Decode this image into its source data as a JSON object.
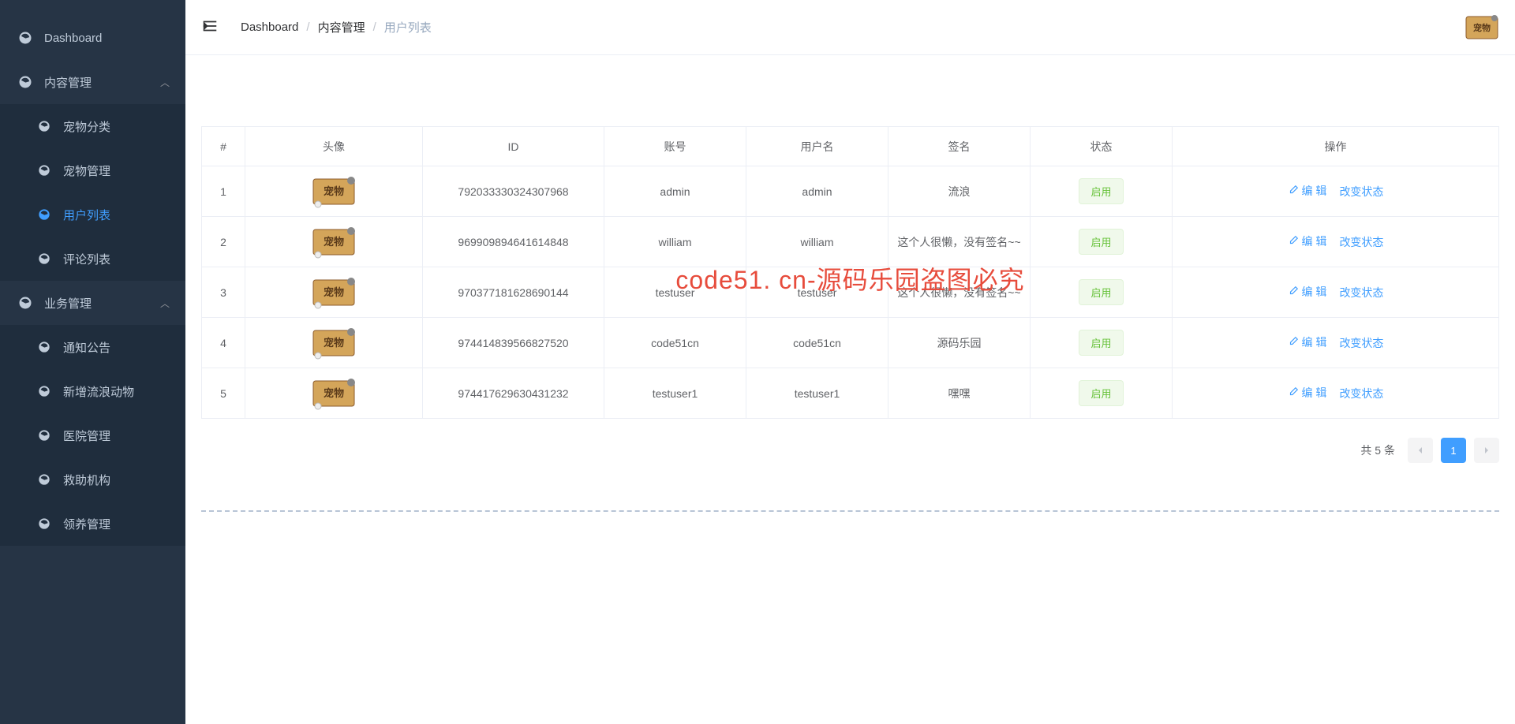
{
  "sidebar": {
    "dashboard": "Dashboard",
    "content_mgmt": "内容管理",
    "content_sub": [
      "宠物分类",
      "宠物管理",
      "用户列表",
      "评论列表"
    ],
    "business_mgmt": "业务管理",
    "business_sub": [
      "通知公告",
      "新增流浪动物",
      "医院管理",
      "救助机构",
      "领养管理"
    ]
  },
  "breadcrumb": {
    "dashboard": "Dashboard",
    "content": "内容管理",
    "current": "用户列表"
  },
  "watermark": "code51. cn-源码乐园盗图必究",
  "table": {
    "headers": {
      "idx": "#",
      "avatar": "头像",
      "id": "ID",
      "account": "账号",
      "username": "用户名",
      "sign": "签名",
      "status": "状态",
      "op": "操作"
    },
    "status_label": "启用",
    "edit_label": "编 辑",
    "change_label": "改变状态",
    "rows": [
      {
        "idx": "1",
        "id": "792033330324307968",
        "account": "admin",
        "username": "admin",
        "sign": "流浪"
      },
      {
        "idx": "2",
        "id": "969909894641614848",
        "account": "william",
        "username": "william",
        "sign": "这个人很懒，没有签名~~"
      },
      {
        "idx": "3",
        "id": "970377181628690144",
        "account": "testuser",
        "username": "testuser",
        "sign": "这个人很懒，没有签名~~"
      },
      {
        "idx": "4",
        "id": "974414839566827520",
        "account": "code51cn",
        "username": "code51cn",
        "sign": "源码乐园"
      },
      {
        "idx": "5",
        "id": "974417629630431232",
        "account": "testuser1",
        "username": "testuser1",
        "sign": "嘿嘿"
      }
    ]
  },
  "pagination": {
    "total_text": "共 5 条",
    "page": "1"
  }
}
